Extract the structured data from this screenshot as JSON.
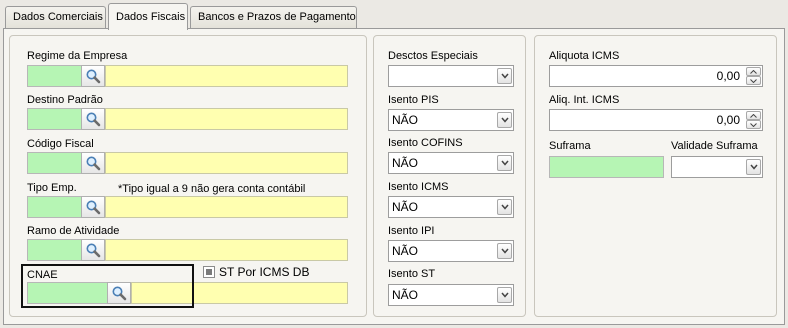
{
  "tabs": [
    {
      "label": "Dados Comerciais"
    },
    {
      "label": "Dados Fiscais"
    },
    {
      "label": "Bancos e Prazos de Pagamento"
    }
  ],
  "left": {
    "regime_label": "Regime da Empresa",
    "destino_label": "Destino Padrão",
    "codigo_fiscal_label": "Código Fiscal",
    "tipo_emp_label": "Tipo Emp.",
    "tipo_emp_note": "*Tipo igual a 9 não gera conta contábil",
    "ramo_label": "Ramo de Atividade",
    "cnae_label": "CNAE",
    "st_checkbox_label": "ST Por ICMS DB"
  },
  "middle": {
    "desctos_label": "Desctos Especiais",
    "desctos_value": "",
    "isento_pis_label": "Isento PIS",
    "isento_pis_value": "NÃO",
    "isento_cofins_label": "Isento COFINS",
    "isento_cofins_value": "NÃO",
    "isento_icms_label": "Isento ICMS",
    "isento_icms_value": "NÃO",
    "isento_ipi_label": "Isento IPI",
    "isento_ipi_value": "NÃO",
    "isento_st_label": "Isento ST",
    "isento_st_value": "NÃO"
  },
  "right": {
    "aliquota_label": "Aliquota ICMS",
    "aliquota_value": "0,00",
    "aliq_int_label": "Aliq. Int. ICMS",
    "aliq_int_value": "0,00",
    "suframa_label": "Suframa",
    "suframa_value": "",
    "validade_label": "Validade Suframa",
    "validade_value": ""
  },
  "colors": {
    "code_field": "#b6f5b4",
    "desc_field": "#ffffb0",
    "background": "#ebe9e4"
  },
  "icons": {
    "lookup": "magnifier-icon",
    "dropdown": "chevron-down-icon",
    "spin_up": "spin-up-icon",
    "spin_down": "spin-down-icon"
  }
}
